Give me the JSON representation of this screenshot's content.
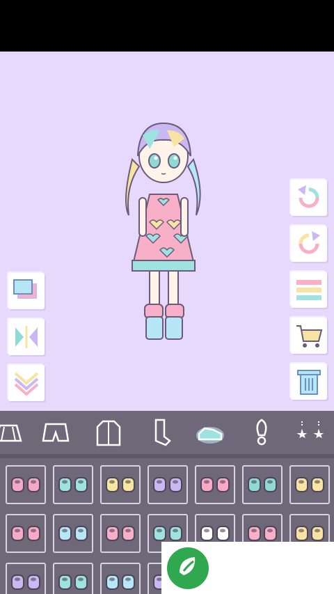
{
  "colors": {
    "stage_bg": "#e6d9fb",
    "panel_bg": "#6e6878",
    "slot_border": "#d9d3e3",
    "ad_green": "#2fa84f"
  },
  "side_buttons_left": [
    "background-icon",
    "flip-icon",
    "collapse-icon"
  ],
  "side_buttons_right": [
    "undo-icon",
    "redo-icon",
    "menu-icon",
    "shop-cart-icon",
    "trash-icon"
  ],
  "categories": [
    "skirt-icon",
    "shorts-icon",
    "jacket-icon",
    "socks-icon",
    "shoes-icon",
    "accessory-icon",
    "hair-clip-icon"
  ],
  "selected_category": "shoes-icon",
  "shoe_items": [
    {
      "color": "#f3a8c7"
    },
    {
      "color": "#9fe3e0"
    },
    {
      "color": "#f5e6a0"
    },
    {
      "color": "#c9b8f2"
    },
    {
      "color": "#f7a9c5"
    },
    {
      "color": "#8fdad4"
    },
    {
      "color": "#f7e4a3"
    },
    {
      "color": "#f7a9c5"
    },
    {
      "color": "#b7e6f7"
    },
    {
      "color": "#f7b0c8"
    },
    {
      "color": "#9fe3e0"
    },
    {
      "color": "#ffffff"
    },
    {
      "color": "#f7b0c8"
    },
    {
      "color": "#f7e4a3"
    },
    {
      "color": "#c9b8f2"
    },
    {
      "color": "#9fe3e0"
    },
    {
      "color": "#b7e6f7"
    },
    {
      "color": "#c9b8f2"
    }
  ]
}
